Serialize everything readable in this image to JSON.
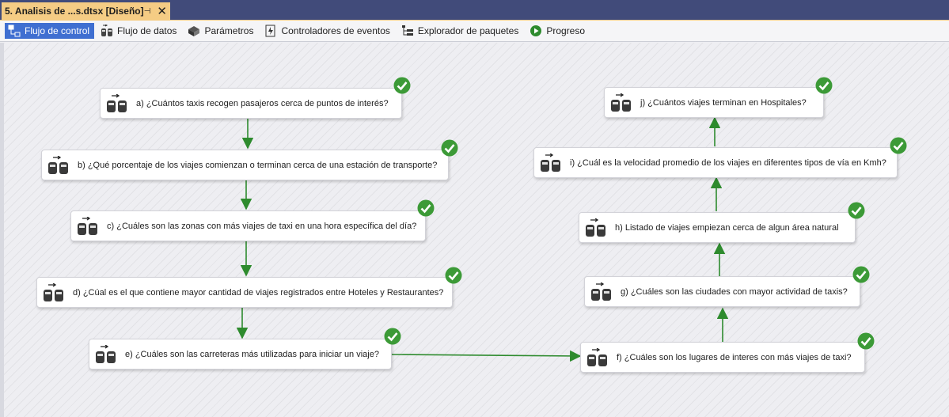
{
  "document_tab": {
    "title": "5. Analisis de ...s.dtsx [Diseño]",
    "pin_glyph": "⊣",
    "close_glyph": "✕"
  },
  "designer_tabs": [
    {
      "label": "Flujo de control",
      "icon": "control-flow-icon",
      "active": true
    },
    {
      "label": "Flujo de datos",
      "icon": "data-flow-icon",
      "active": false
    },
    {
      "label": "Parámetros",
      "icon": "parameters-icon",
      "active": false
    },
    {
      "label": "Controladores de eventos",
      "icon": "event-handlers-icon",
      "active": false
    },
    {
      "label": "Explorador de paquetes",
      "icon": "package-explorer-icon",
      "active": false
    },
    {
      "label": "Progreso",
      "icon": "progress-icon",
      "active": false
    }
  ],
  "tasks": [
    {
      "id": "a",
      "label": "a) ¿Cuántos taxis recogen pasajeros cerca de puntos de interés?",
      "status": "success"
    },
    {
      "id": "b",
      "label": "b) ¿Qué porcentaje de los viajes comienzan o terminan cerca de una estación de transporte?",
      "status": "success"
    },
    {
      "id": "c",
      "label": "c) ¿Cuáles son las zonas con más viajes de taxi en una hora específica del día?",
      "status": "success"
    },
    {
      "id": "d",
      "label": "d) ¿Cúal es el que contiene mayor cantidad de viajes registrados entre Hoteles y Restaurantes?",
      "status": "success"
    },
    {
      "id": "e",
      "label": "e) ¿Cuáles son las carreteras más utilizadas para iniciar un viaje?",
      "status": "success"
    },
    {
      "id": "f",
      "label": "f) ¿Cuáles son los lugares de interes con más viajes de taxi?",
      "status": "success"
    },
    {
      "id": "g",
      "label": "g) ¿Cuáles son las ciudades con mayor actividad de taxis?",
      "status": "success"
    },
    {
      "id": "h",
      "label": "h) Listado de viajes empiezan cerca de algun área natural",
      "status": "success"
    },
    {
      "id": "i",
      "label": "i) ¿Cuál es la velocidad promedio de los viajes en diferentes tipos de vía en Kmh?",
      "status": "success"
    },
    {
      "id": "j",
      "label": "j) ¿Cuántos viajes terminan en Hospitales?",
      "status": "success"
    }
  ],
  "colors": {
    "success": "#3c9a37",
    "connector": "#2e8b2e",
    "active_tab": "#3f6fd1",
    "doc_tab": "#f5cc84"
  }
}
